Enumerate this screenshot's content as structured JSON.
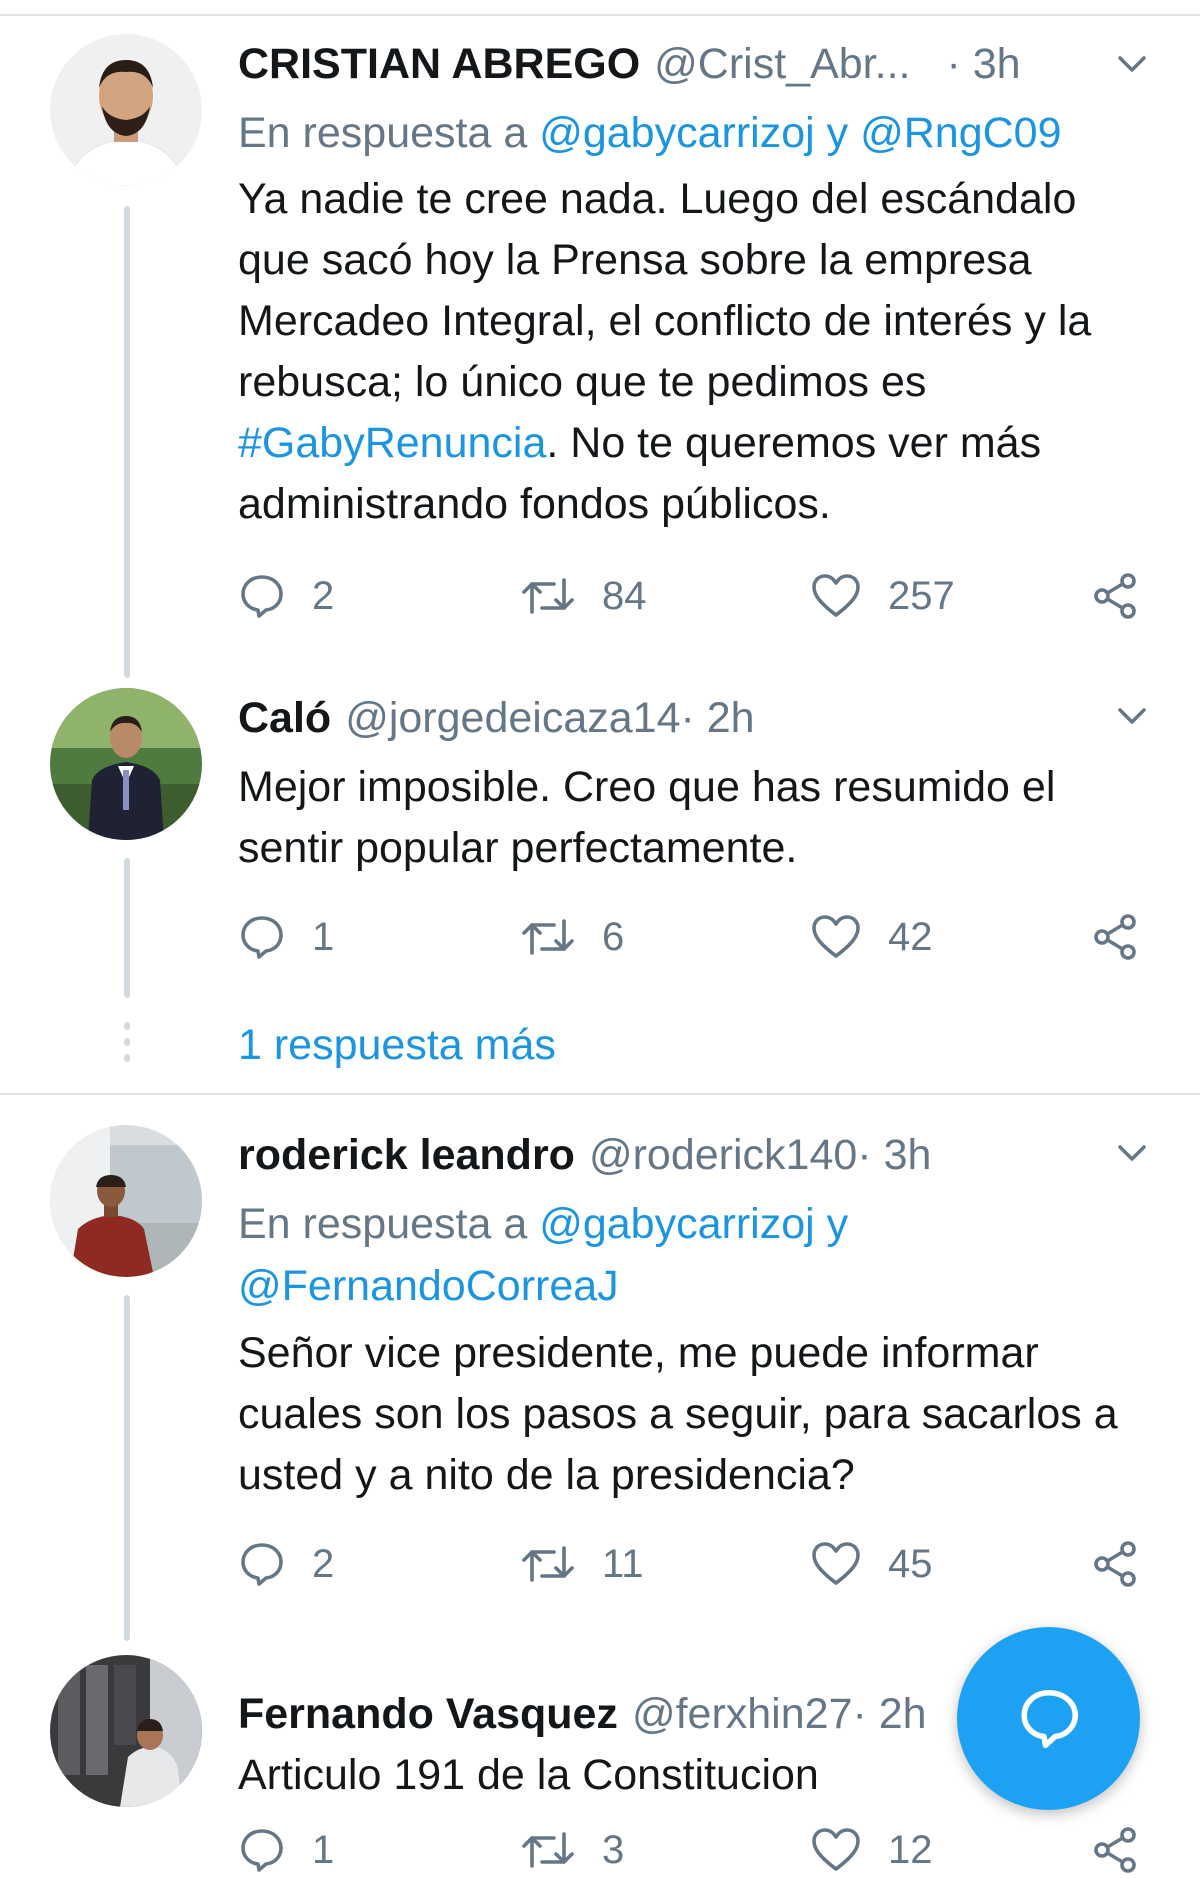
{
  "colors": {
    "link": "#1b95e0",
    "secondary_text": "#657786",
    "fab": "#1da1f2",
    "thread_line": "#cfd9de"
  },
  "tweets": [
    {
      "name": "CRISTIAN ABREGO",
      "handle": "@Crist_Abr...",
      "time": "· 3h",
      "reply_prefix": "En respuesta a ",
      "reply_user1": "@gabycarrizoj",
      "reply_and": " y ",
      "reply_user2": "@RngC09",
      "text_before": "Ya nadie te cree nada. Luego del escándalo que sacó hoy la Prensa sobre la empresa Mercadeo Integral, el conflicto de interés y la rebusca; lo único que te pedimos es ",
      "hashtag": "#GabyRenuncia",
      "text_after": ". No te queremos ver más administrando fondos públicos.",
      "replies": "2",
      "retweets": "84",
      "likes": "257",
      "avatar_icon": "avatar-photo"
    },
    {
      "name": "Caló",
      "handle": "@jorgedeicaza14",
      "time": " · 2h",
      "text": "Mejor imposible.  Creo que has resumido el sentir popular perfectamente.",
      "replies": "1",
      "retweets": "6",
      "likes": "42",
      "avatar_icon": "avatar-photo"
    },
    {
      "name": "roderick leandro",
      "handle": "@roderick140",
      "time": " · 3h",
      "reply_prefix": "En respuesta a ",
      "reply_user1": "@gabycarrizoj",
      "reply_and": " y ",
      "reply_user2": "@FernandoCorreaJ",
      "text": "Señor vice presidente, me puede informar cuales son los pasos a seguir, para sacarlos a usted y a nito de la presidencia?",
      "replies": "2",
      "retweets": "11",
      "likes": "45",
      "avatar_icon": "avatar-photo"
    },
    {
      "name": "Fernando Vasquez",
      "handle": "@ferxhin27",
      "time": " · 2h",
      "text": "Articulo 191 de la Constitucion",
      "replies": "1",
      "retweets": "3",
      "likes": "12",
      "avatar_icon": "avatar-photo"
    }
  ],
  "more_replies_label": "1 respuesta más",
  "fab_icon": "compose-reply-icon"
}
